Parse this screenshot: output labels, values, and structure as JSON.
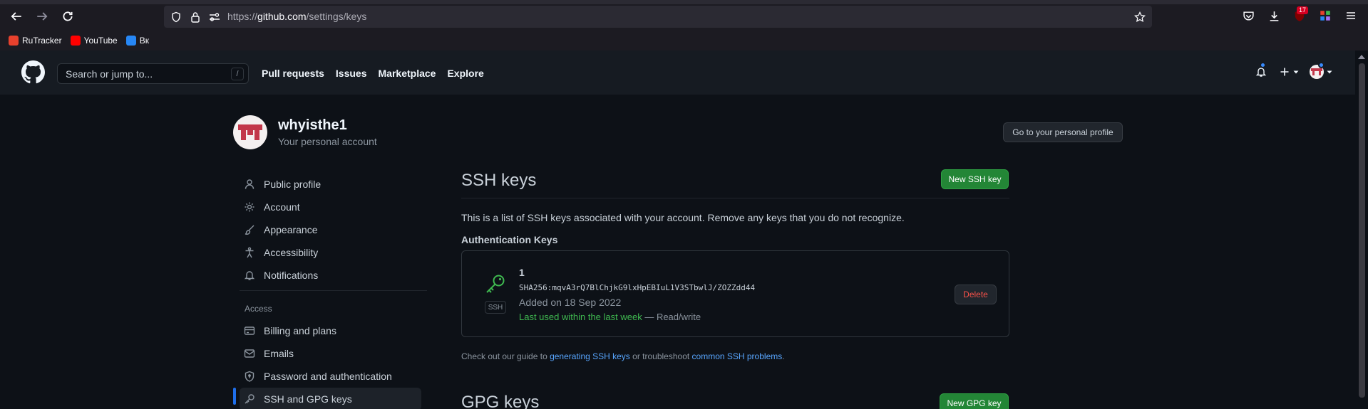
{
  "browser": {
    "url_scheme": "https://",
    "url_host": "github.com",
    "url_path": "/settings/keys",
    "extension_badge": "17",
    "bookmarks": [
      {
        "label": "RuTracker",
        "icon": "rutracker-icon",
        "color": "#e8412d"
      },
      {
        "label": "YouTube",
        "icon": "youtube-icon",
        "color": "#ff0000"
      },
      {
        "label": "Вк",
        "icon": "vk-icon",
        "color": "#2787f5"
      }
    ]
  },
  "header": {
    "search_placeholder": "Search or jump to...",
    "search_shortcut": "/",
    "nav": [
      "Pull requests",
      "Issues",
      "Marketplace",
      "Explore"
    ]
  },
  "profile": {
    "username": "whyisthe1",
    "subtitle": "Your personal account",
    "goto_button": "Go to your personal profile"
  },
  "sidebar": {
    "items": [
      {
        "label": "Public profile",
        "icon": "person-icon"
      },
      {
        "label": "Account",
        "icon": "gear-icon"
      },
      {
        "label": "Appearance",
        "icon": "paintbrush-icon"
      },
      {
        "label": "Accessibility",
        "icon": "accessibility-icon"
      },
      {
        "label": "Notifications",
        "icon": "bell-icon"
      }
    ],
    "access_heading": "Access",
    "access_items": [
      {
        "label": "Billing and plans",
        "icon": "credit-card-icon"
      },
      {
        "label": "Emails",
        "icon": "mail-icon"
      },
      {
        "label": "Password and authentication",
        "icon": "shield-icon"
      },
      {
        "label": "SSH and GPG keys",
        "icon": "key-icon",
        "active": true
      }
    ]
  },
  "main": {
    "title": "SSH keys",
    "new_ssh_button": "New SSH key",
    "description": "This is a list of SSH keys associated with your account. Remove any keys that you do not recognize.",
    "auth_heading": "Authentication Keys",
    "key": {
      "type_label": "SSH",
      "title": "1",
      "fingerprint": "SHA256:mqvA3rQ7BlChjkG9lxHpEBIuL1V3STbwlJ/ZOZZdd44",
      "added": "Added on 18 Sep 2022",
      "last_used": "Last used within the last week",
      "access": " — Read/write",
      "delete_button": "Delete"
    },
    "guide_prefix": "Check out our guide to ",
    "guide_link1": "generating SSH keys",
    "guide_middle": " or troubleshoot ",
    "guide_link2": "common SSH problems",
    "guide_suffix": ".",
    "gpg_title": "GPG keys",
    "new_gpg_button": "New GPG key"
  },
  "colors": {
    "accent_green": "#238636",
    "link_blue": "#58a6ff",
    "danger_red": "#f85149",
    "background": "#0d1117"
  }
}
